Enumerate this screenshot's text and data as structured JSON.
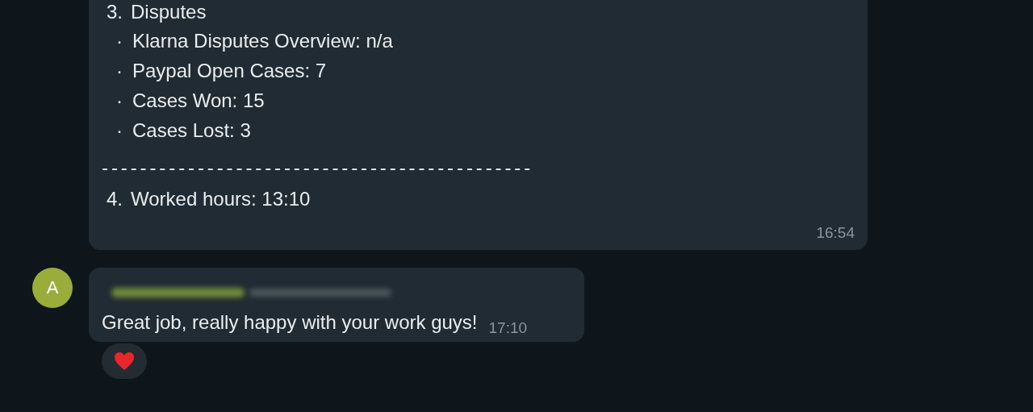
{
  "messages": [
    {
      "kind": "report",
      "heading": {
        "number": "3.",
        "text": "Disputes"
      },
      "bullets": [
        {
          "marker": "·",
          "text": "Klarna Disputes Overview: n/a"
        },
        {
          "marker": "·",
          "text": "Paypal Open Cases: 7"
        },
        {
          "marker": "·",
          "text": "Cases Won: 15"
        },
        {
          "marker": "·",
          "text": "Cases Lost: 3"
        }
      ],
      "divider": "---------------------------------------------",
      "items": [
        {
          "number": "4.",
          "text": "Worked hours: 13:10"
        }
      ],
      "time": "16:54"
    },
    {
      "kind": "incoming",
      "avatar": "A",
      "text": "Great job, really happy with your work guys!",
      "time": "17:10",
      "reactions": [
        {
          "kind": "heart"
        }
      ]
    }
  ]
}
